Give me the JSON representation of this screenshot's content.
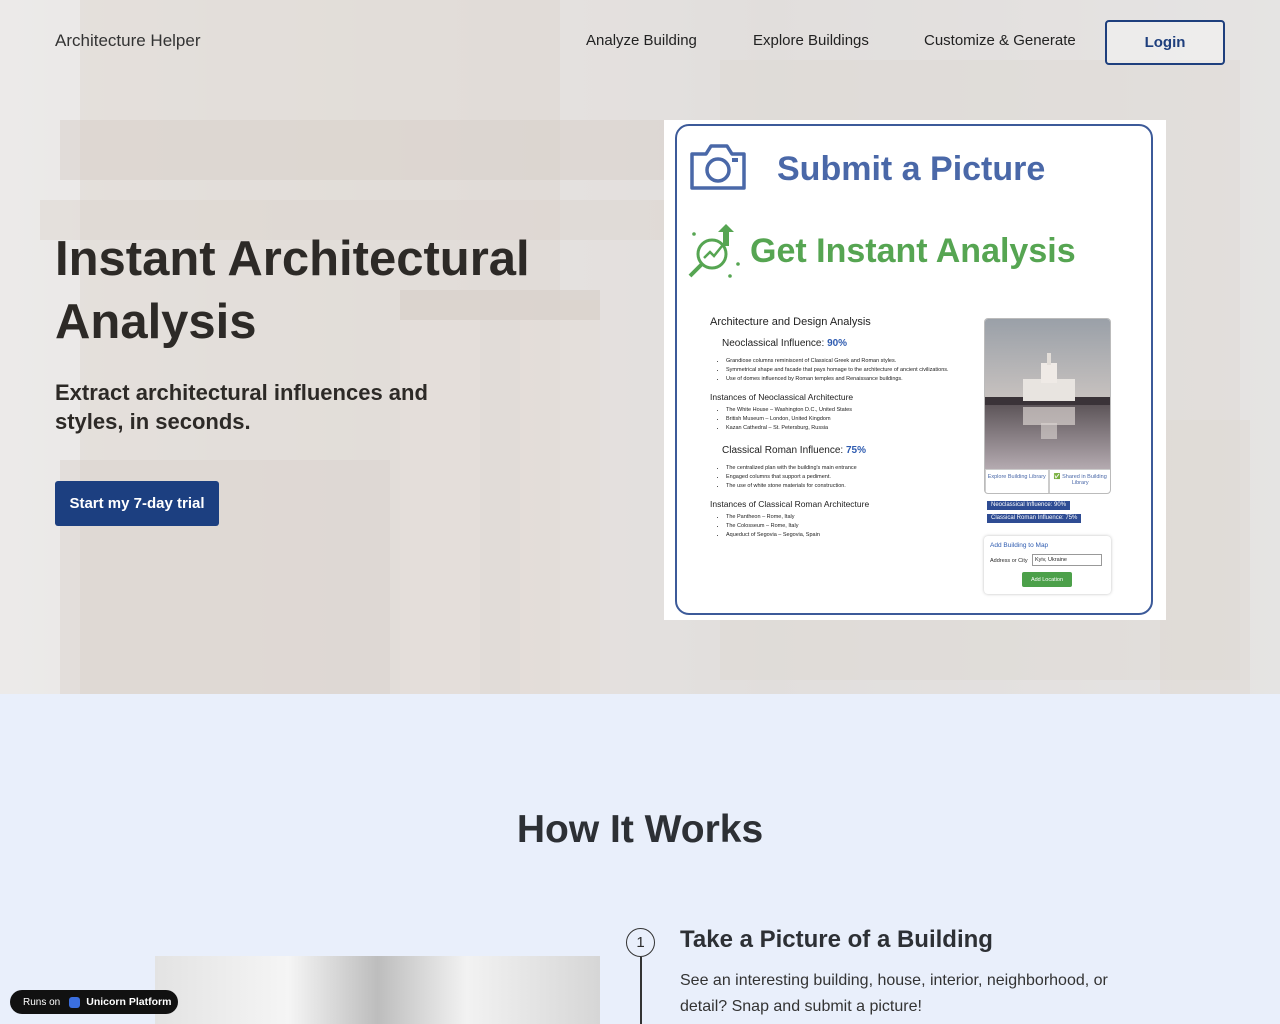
{
  "nav": {
    "brand": "Architecture Helper",
    "links": [
      "Analyze Building",
      "Explore Buildings",
      "Customize & Generate"
    ],
    "login": "Login"
  },
  "hero": {
    "title": "Instant Architectural Analysis",
    "subtitle": "Extract architectural influences and styles, in seconds.",
    "cta": "Start my 7-day trial"
  },
  "preview": {
    "submit_label": "Submit a Picture",
    "analysis_label": "Get Instant Analysis",
    "report_title": "Architecture and Design Analysis",
    "neo_label": "Neoclassical Influence:",
    "neo_value": "90%",
    "neo_points": [
      "Grandiose columns reminiscent of Classical Greek and Roman styles.",
      "Symmetrical shape and facade that pays homage to the architecture of ancient civilizations.",
      "Use of domes influenced by Roman temples and Renaissance buildings."
    ],
    "neo_instances_title": "Instances of Neoclassical Architecture",
    "neo_instances": [
      "The White House – Washington D.C., United States",
      "British Museum – London, United Kingdom",
      "Kazan Cathedral – St. Petersburg, Russia"
    ],
    "roman_label": "Classical Roman Influence:",
    "roman_value": "75%",
    "roman_points": [
      "The centralized plan with the building's main entrance",
      "Engaged columns that support a pediment.",
      "The use of white stone materials for construction."
    ],
    "roman_instances_title": "Instances of Classical Roman Architecture",
    "roman_instances": [
      "The Pantheon – Rome, Italy",
      "The Colosseum – Rome, Italy",
      "Aqueduct of Segovia – Segovia, Spain"
    ],
    "explore_library": "Explore Building Library",
    "shared_library": "✅ Shared in Building Library",
    "badge_neo": "Neoclassical Influence: 90%",
    "badge_roman": "Classical Roman Influence: 75%",
    "map_title": "Add Building to Map",
    "map_label": "Address or City",
    "map_value": "Kyiv, Ukraine",
    "map_button": "Add Location"
  },
  "how": {
    "title": "How It Works",
    "step_number": "1",
    "step_title": "Take a Picture of a Building",
    "step_desc": "See an interesting building, house, interior, neighborhood, or detail? Snap and submit a picture!"
  },
  "badge": {
    "runs_on": "Runs on",
    "platform": "Unicorn Platform"
  },
  "colors": {
    "primary": "#1c3f80",
    "accent_blue": "#4a68a8",
    "accent_green": "#56a552",
    "section_bg": "#e9effb"
  }
}
